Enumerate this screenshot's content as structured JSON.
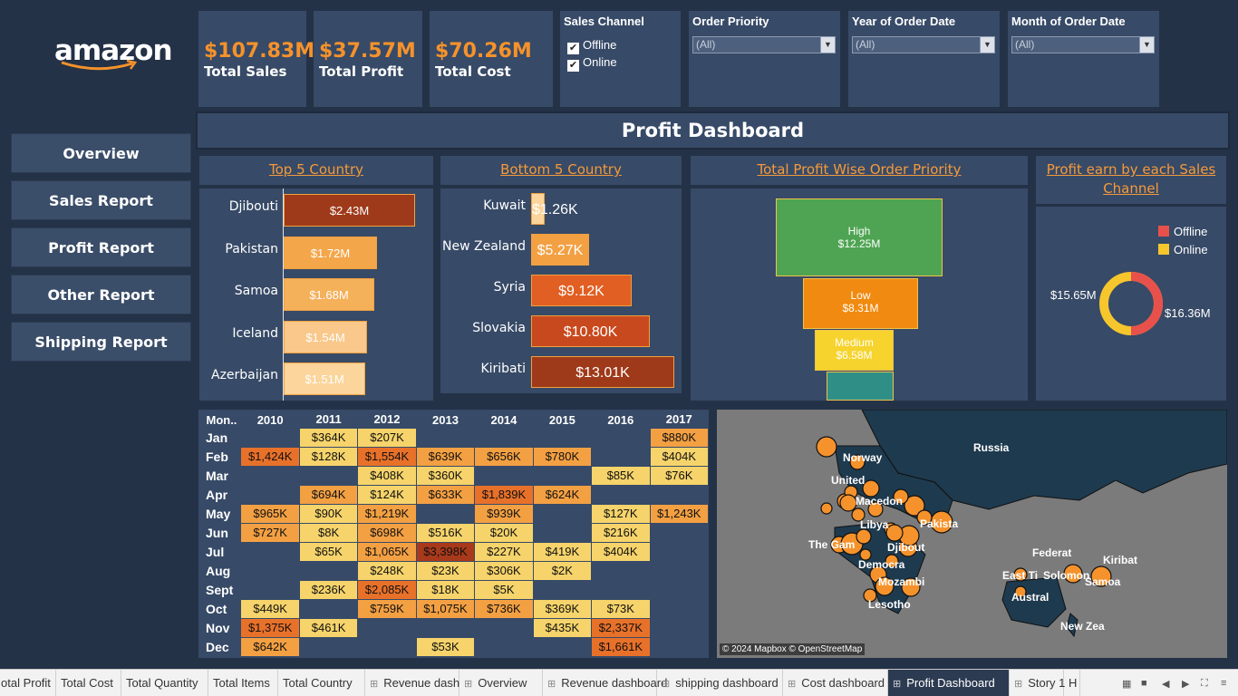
{
  "logo": {
    "text": "amazon"
  },
  "kpis": [
    {
      "value": "$107.83M",
      "label": "Total Sales"
    },
    {
      "value": "$37.57M",
      "label": "Total Profit"
    },
    {
      "value": "$70.26M",
      "label": "Total Cost"
    }
  ],
  "filters": {
    "sales_channel": {
      "title": "Sales Channel",
      "options": [
        "Offline",
        "Online"
      ]
    },
    "order_priority": {
      "title": "Order Priority",
      "value": "(All)"
    },
    "year": {
      "title": "Year of Order Date",
      "value": "(All)"
    },
    "month": {
      "title": "Month of Order Date",
      "value": "(All)"
    }
  },
  "nav": [
    "Overview",
    "Sales Report",
    "Profit Report",
    "Other Report",
    "Shipping Report"
  ],
  "dashboard_title": "Profit Dashboard",
  "top5": {
    "title": "Top 5 Country",
    "countries": [
      "Djibouti",
      "Pakistan",
      "Samoa",
      "Iceland",
      "Azerbaijan"
    ],
    "labels": [
      "$2.43M",
      "$1.72M",
      "$1.68M",
      "$1.54M",
      "$1.51M"
    ],
    "values": [
      2.43,
      1.72,
      1.68,
      1.54,
      1.51
    ],
    "colors": [
      "#9e3a1a",
      "#f4a64a",
      "#f5b05a",
      "#f9c88a",
      "#fbd59b"
    ]
  },
  "bottom5": {
    "title": "Bottom 5 Country",
    "countries": [
      "Kuwait",
      "New Zealand",
      "Syria",
      "Slovakia",
      "Kiribati"
    ],
    "labels": [
      "$1.26K",
      "$5.27K",
      "$9.12K",
      "$10.80K",
      "$13.01K"
    ],
    "values": [
      1.26,
      5.27,
      9.12,
      10.8,
      13.01
    ],
    "colors": [
      "#fbd59b",
      "#f3a043",
      "#e15f22",
      "#c8491d",
      "#9e3a1a"
    ]
  },
  "priority": {
    "title": "Total Profit Wise Order Priority",
    "items": [
      {
        "name": "High",
        "value": "$12.25M",
        "color": "#4ea452"
      },
      {
        "name": "Low",
        "value": "$8.31M",
        "color": "#f08a10"
      },
      {
        "name": "Medium",
        "value": "$6.58M",
        "color": "#f6d32d"
      },
      {
        "name": "",
        "value": "",
        "color": "#2f8f86"
      }
    ]
  },
  "channel": {
    "title": "Profit earn by each Sales Channel",
    "legend": [
      "Offline",
      "Online"
    ],
    "colors": [
      "#e8514b",
      "#f6c62d"
    ],
    "labels": [
      "$15.65M",
      "$16.36M"
    ]
  },
  "heatmap": {
    "corner": "Mon..",
    "years": [
      "2010",
      "2011",
      "2012",
      "2013",
      "2014",
      "2015",
      "2016",
      "2017"
    ],
    "months": [
      "Jan",
      "Feb",
      "Mar",
      "Apr",
      "May",
      "Jun",
      "Jul",
      "Aug",
      "Sept",
      "Oct",
      "Nov",
      "Dec"
    ],
    "cells": [
      [
        "",
        "$364K",
        "$207K",
        "",
        "",
        "",
        "",
        "$880K"
      ],
      [
        "$1,424K",
        "$128K",
        "$1,554K",
        "$639K",
        "$656K",
        "$780K",
        "",
        "$404K"
      ],
      [
        "",
        "",
        "$408K",
        "$360K",
        "",
        "",
        "$85K",
        "$76K"
      ],
      [
        "",
        "$694K",
        "$124K",
        "$633K",
        "$1,839K",
        "$624K",
        "",
        ""
      ],
      [
        "$965K",
        "$90K",
        "$1,219K",
        "",
        "$939K",
        "",
        "$127K",
        "$1,243K"
      ],
      [
        "$727K",
        "$8K",
        "$698K",
        "$516K",
        "$20K",
        "",
        "$216K",
        ""
      ],
      [
        "",
        "$65K",
        "$1,065K",
        "$3,398K",
        "$227K",
        "$419K",
        "$404K",
        ""
      ],
      [
        "",
        "",
        "$248K",
        "$23K",
        "$306K",
        "$2K",
        "",
        ""
      ],
      [
        "",
        "$236K",
        "$2,085K",
        "$18K",
        "$5K",
        "",
        "",
        ""
      ],
      [
        "$449K",
        "",
        "$759K",
        "$1,075K",
        "$736K",
        "$369K",
        "$73K",
        ""
      ],
      [
        "$1,375K",
        "$461K",
        "",
        "",
        "",
        "$435K",
        "$2,337K",
        ""
      ],
      [
        "$642K",
        "",
        "",
        "$53K",
        "",
        "",
        "$1,661K",
        ""
      ]
    ],
    "colors": {
      "low": "#f6d46b",
      "mid": "#f3a043",
      "high": "#e8712a",
      "top": "#a8391b"
    }
  },
  "map": {
    "labels": [
      "Russia",
      "Norway",
      "United",
      "Macedon",
      "Pakista",
      "Libya",
      "The Gam",
      "Djibout",
      "Democra",
      "Mozambi",
      "Lesotho",
      "Federat",
      "Kiribat",
      "East Ti",
      "Solomon",
      "Samoa",
      "Austral",
      "New Zea"
    ],
    "attribution": "© 2024 Mapbox © OpenStreetMap",
    "land_color": "#1e3a4e",
    "bubble_color": "#f5922b"
  },
  "tabs": [
    "otal Profit",
    "Total Cost",
    "Total Quantity",
    "Total Items",
    "Total Country",
    "Revenue dash",
    "Overview",
    "Revenue dashboard",
    "shipping dashboard",
    "Cost dashboard",
    "Profit Dashboard",
    "Story 1",
    "H"
  ]
}
